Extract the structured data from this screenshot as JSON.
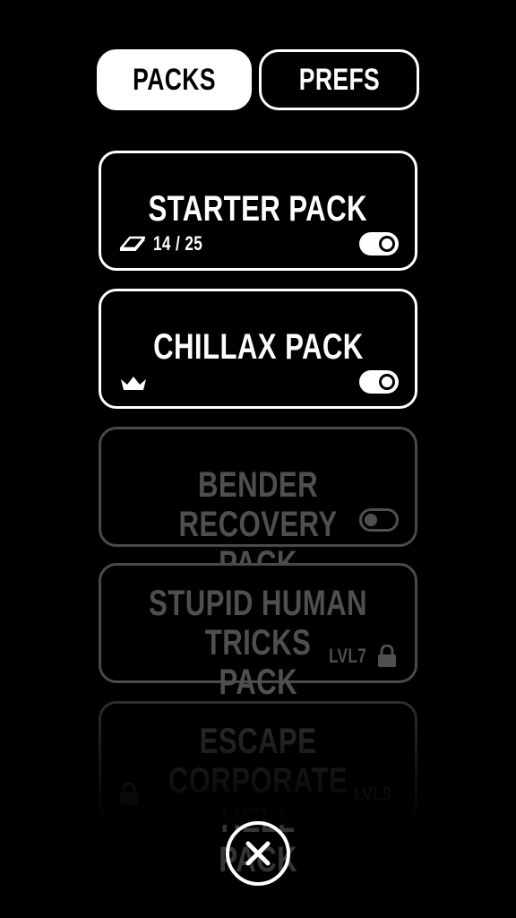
{
  "tabs": {
    "packs_label": "PACKS",
    "prefs_label": "PREFS"
  },
  "packs": [
    {
      "title": "STARTER PACK",
      "progress": "14 / 25",
      "toggle": "on",
      "badge": "card-icon"
    },
    {
      "title": "CHILLAX PACK",
      "toggle": "on",
      "badge": "crown-icon"
    },
    {
      "title": "BENDER RECOVERY PACK",
      "toggle": "off",
      "state": "dim"
    },
    {
      "title_line1": "STUPID HUMAN TRICKS",
      "title_line2": "PACK",
      "level": "LVL7",
      "state": "locked"
    },
    {
      "title_line1": "ESCAPE CORPORATE HELL",
      "title_line2": "PACK",
      "level": "LVL9",
      "state": "locked"
    }
  ],
  "colors": {
    "background": "#000000",
    "active": "#ffffff",
    "dim": "#4f4f4f",
    "dimmer": "#353535"
  },
  "icons": {
    "close": "close-icon",
    "lock": "lock-icon",
    "crown": "crown-icon",
    "card": "card-icon"
  }
}
